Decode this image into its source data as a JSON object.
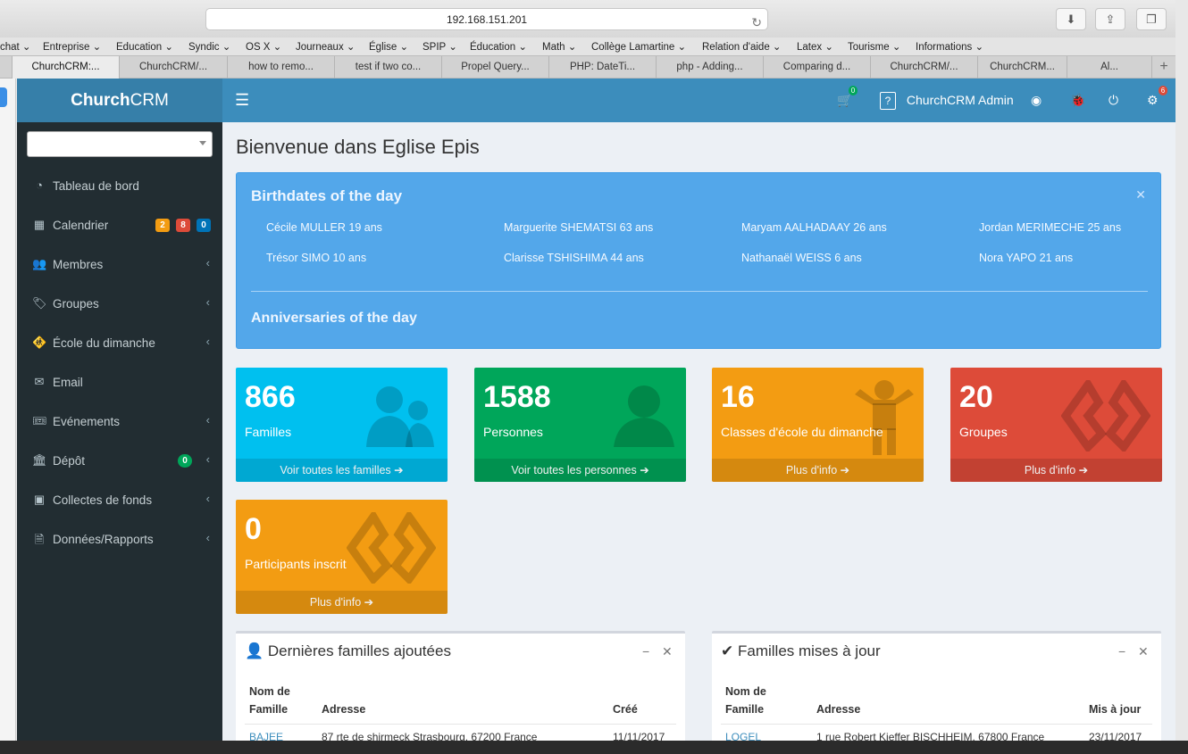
{
  "browser": {
    "url": "192.168.151.201",
    "bookmarks": [
      "chat ⌄",
      "Entreprise ⌄",
      "Education ⌄",
      "Syndic ⌄",
      "OS X ⌄",
      "Journeaux ⌄",
      "Église ⌄",
      "SPIP ⌄",
      "Éducation ⌄",
      "Math ⌄",
      "Collège Lamartine ⌄",
      "Relation d'aide ⌄",
      "Latex ⌄",
      "Tourisme ⌄",
      "Informations ⌄"
    ],
    "tabs": [
      "ChurchCRM:...",
      "ChurchCRM/...",
      "how to remo...",
      "test if two co...",
      "Propel Query...",
      "PHP: DateTi...",
      "php - Adding...",
      "Comparing d...",
      "ChurchCRM/...",
      "ChurchCRM...",
      "Al..."
    ]
  },
  "sidebar": {
    "logo_bold": "Church",
    "logo_rest": "CRM",
    "items": [
      {
        "label": "Tableau de bord",
        "icon": "dashboard-icon"
      },
      {
        "label": "Calendrier",
        "icon": "calendar-icon",
        "badges": [
          "2",
          "8",
          "0"
        ]
      },
      {
        "label": "Membres",
        "icon": "users-icon"
      },
      {
        "label": "Groupes",
        "icon": "tag-icon"
      },
      {
        "label": "École du dimanche",
        "icon": "child-icon"
      },
      {
        "label": "Email",
        "icon": "envelope-icon"
      },
      {
        "label": "Evénements",
        "icon": "ticket-icon"
      },
      {
        "label": "Dépôt",
        "icon": "bank-icon",
        "badge": "0"
      },
      {
        "label": "Collectes de fonds",
        "icon": "money-icon"
      },
      {
        "label": "Données/Rapports",
        "icon": "file-pdf-icon"
      }
    ]
  },
  "topbar": {
    "cart_count": "0",
    "user": "ChurchCRM Admin",
    "settings_count": "6"
  },
  "main": {
    "welcome": "Bienvenue dans Eglise Epis",
    "birthdays_title": "Birthdates of the day",
    "birthdays": [
      "Cécile MULLER 19 ans",
      "Marguerite SHEMATSI 63 ans",
      "Maryam AALHADAAY 26 ans",
      "Jordan MERIMECHE 25 ans",
      "Trésor SIMO 10 ans",
      "Clarisse TSHISHIMA 44 ans",
      "Nathanaël WEISS 6 ans",
      "Nora YAPO 21 ans"
    ],
    "anniversaries_title": "Anniversaries of the day",
    "stats": [
      {
        "value": "866",
        "label": "Familles",
        "link": "Voir toutes les familles",
        "color": "#00c0ef"
      },
      {
        "value": "1588",
        "label": "Personnes",
        "link": "Voir toutes les personnes",
        "color": "#00a65a"
      },
      {
        "value": "16",
        "label": "Classes d'école du dimanche",
        "link": "Plus d'info",
        "color": "#f39c12"
      },
      {
        "value": "20",
        "label": "Groupes",
        "link": "Plus d'info",
        "color": "#dd4b39"
      },
      {
        "value": "0",
        "label": "Participants inscrit",
        "link": "Plus d'info",
        "color": "#f39c12"
      }
    ],
    "latest_families": {
      "title": "Dernières familles ajoutées",
      "col_name_1": "Nom de",
      "col_name_2": "Famille",
      "col_address": "Adresse",
      "col_date": "Créé",
      "rows": [
        {
          "name": "BAJEE",
          "address": "87 rte de shirmeck Strasbourg, 67200 France",
          "date": "11/11/2017"
        }
      ]
    },
    "updated_families": {
      "title": "Familles mises à jour",
      "col_name_1": "Nom de",
      "col_name_2": "Famille",
      "col_address": "Adresse",
      "col_date": "Mis à jour",
      "rows": [
        {
          "name": "LOGEL",
          "address": "1 rue Robert Kieffer BISCHHEIM, 67800 France",
          "date": "23/11/2017"
        }
      ]
    }
  }
}
